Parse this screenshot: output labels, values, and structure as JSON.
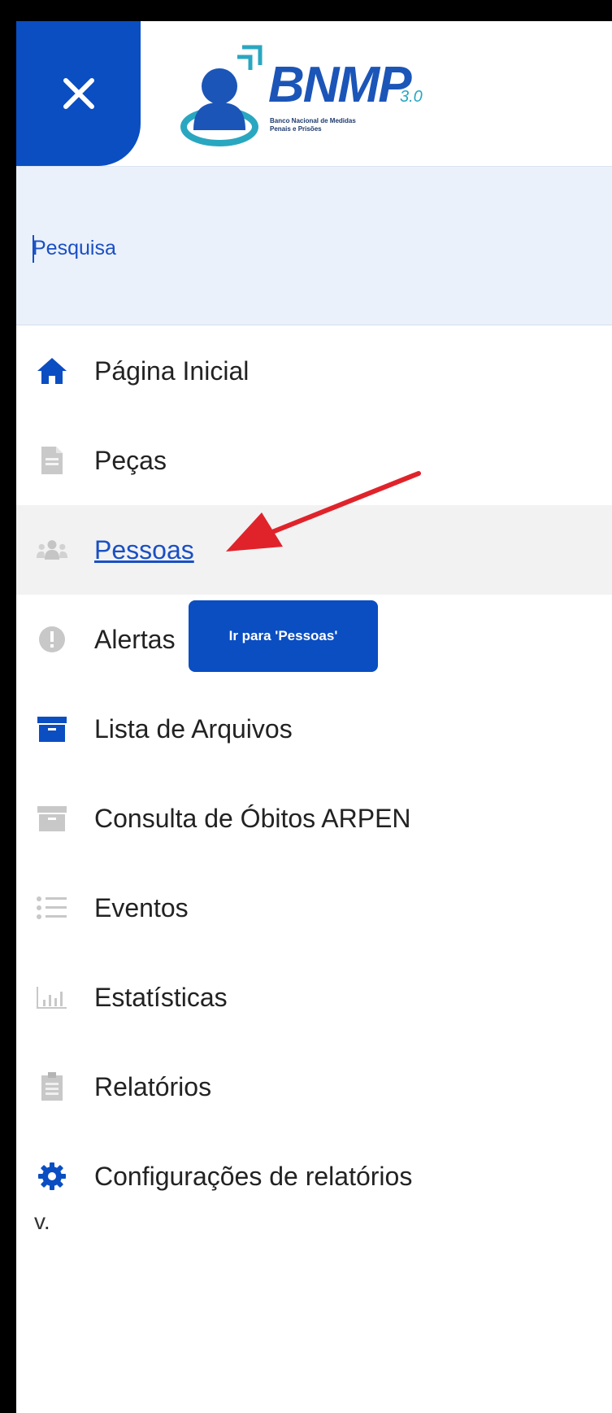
{
  "header": {
    "close_label": "×",
    "logo": {
      "title": "BNMP",
      "version": "3.0",
      "subtitle_line1": "Banco Nacional de Medidas",
      "subtitle_line2": "Penais e Prisões"
    }
  },
  "search": {
    "placeholder": "Pesquisa"
  },
  "menu": {
    "items": [
      {
        "label": "Página Inicial",
        "icon": "home-icon"
      },
      {
        "label": "Peças",
        "icon": "document-icon"
      },
      {
        "label": "Pessoas",
        "icon": "users-icon",
        "active": true
      },
      {
        "label": "Alertas",
        "icon": "alert-icon"
      },
      {
        "label": "Lista de Arquivos",
        "icon": "archive-icon"
      },
      {
        "label": "Consulta de Óbitos ARPEN",
        "icon": "archive-icon"
      },
      {
        "label": "Eventos",
        "icon": "list-icon"
      },
      {
        "label": "Estatísticas",
        "icon": "chart-icon"
      },
      {
        "label": "Relatórios",
        "icon": "clipboard-icon"
      },
      {
        "label": "Configurações de relatórios",
        "icon": "gear-icon"
      }
    ]
  },
  "tooltip": {
    "text": "Ir para 'Pessoas'"
  },
  "footer": {
    "version": "v."
  },
  "colors": {
    "accent": "#0a4ec2",
    "search_bg": "#eaf1fb",
    "active_bg": "#f2f2f2",
    "annotation_arrow": "#e0232b"
  }
}
